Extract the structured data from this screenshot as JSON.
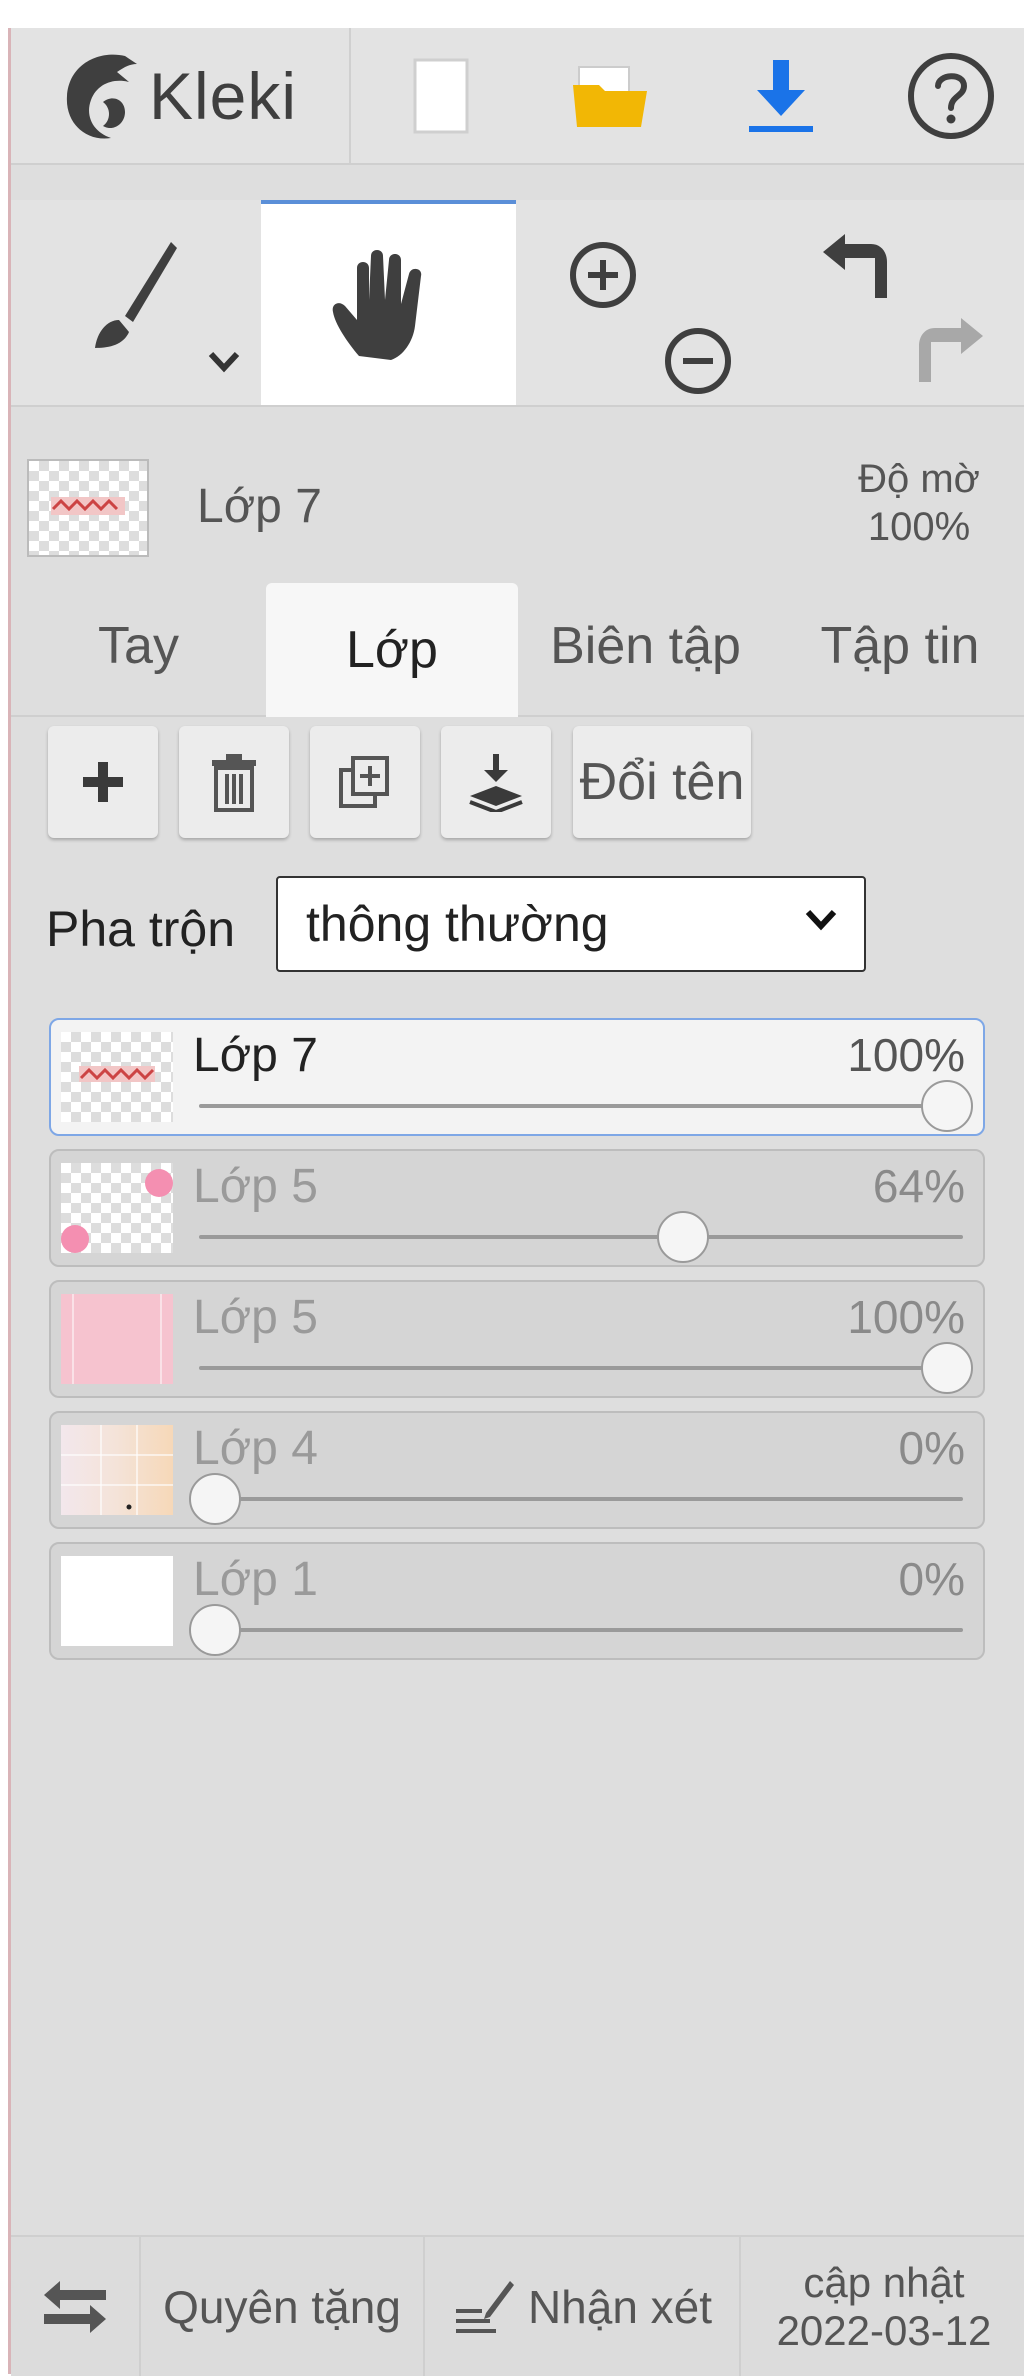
{
  "app": {
    "name": "Kleki"
  },
  "toolbar": {
    "new_icon": "blank-page-icon",
    "open_icon": "folder-icon",
    "save_icon": "download-icon",
    "help_icon": "help-icon"
  },
  "tools": {
    "brush_icon": "brush-icon",
    "hand_icon": "hand-icon",
    "zoom_in_icon": "zoom-in-icon",
    "zoom_out_icon": "zoom-out-icon",
    "undo_icon": "undo-icon",
    "redo_icon": "redo-icon"
  },
  "current_layer": {
    "name": "Lớp 7",
    "opacity_label": "Độ mờ",
    "opacity_value": "100%"
  },
  "tabs": [
    {
      "label": "Tay"
    },
    {
      "label": "Lớp"
    },
    {
      "label": "Biên tập"
    },
    {
      "label": "Tập tin"
    }
  ],
  "layer_actions": {
    "rename_label": "Đổi tên"
  },
  "blend": {
    "label": "Pha trộn",
    "value": "thông thường"
  },
  "layers": [
    {
      "name": "Lớp 7",
      "opacity": "100%",
      "level": 1.0,
      "selected": true
    },
    {
      "name": "Lớp 5",
      "opacity": "64%",
      "level": 0.64,
      "selected": false
    },
    {
      "name": "Lớp 5",
      "opacity": "100%",
      "level": 1.0,
      "selected": false
    },
    {
      "name": "Lớp 4",
      "opacity": "0%",
      "level": 0.0,
      "selected": false
    },
    {
      "name": "Lớp 1",
      "opacity": "0%",
      "level": 0.0,
      "selected": false
    }
  ],
  "footer": {
    "donate_label": "Quyên tặng",
    "feedback_label": "Nhận xét",
    "update_label": "cập nhật",
    "update_date": "2022-03-12"
  },
  "colors": {
    "accent": "#1a73e8",
    "folder": "#f2b705",
    "selected_border": "#7ea7e6"
  }
}
